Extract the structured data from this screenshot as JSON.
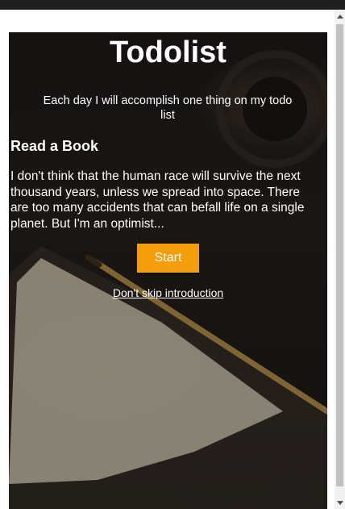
{
  "page": {
    "title": "Todolist",
    "subtitle": "Each day I will accomplish one thing on my todo list"
  },
  "task": {
    "heading": "Read a Book",
    "quote": "I don't think that the human race will survive the next thousand years, unless we spread into space. There are too many accidents that can befall life on a single planet. But I'm an optimist..."
  },
  "actions": {
    "start_label": "Start",
    "intro_link_label": "Don't skip introduction"
  },
  "colors": {
    "accent": "#f59e0b",
    "text": "#ffffff",
    "background": "#1c1816"
  },
  "icons": {
    "background_image": "open-notebook-pencil-photo"
  }
}
